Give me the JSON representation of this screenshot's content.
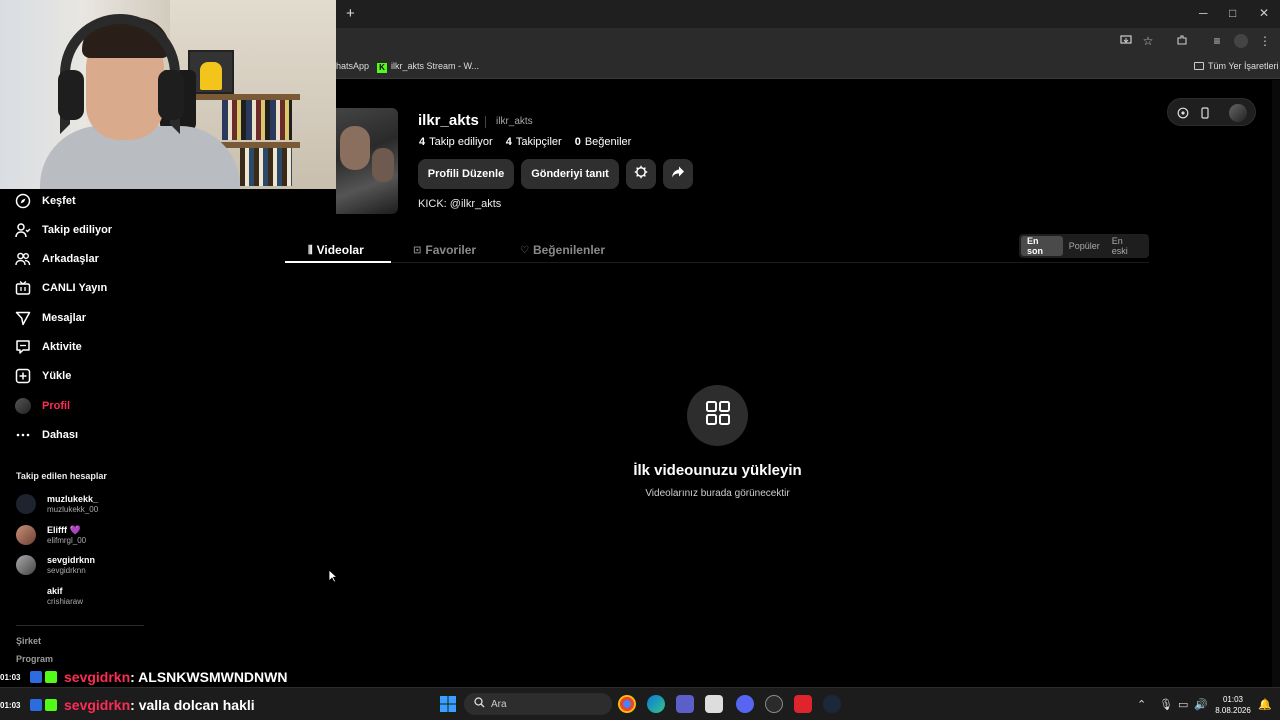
{
  "browser": {
    "new_tab": "+",
    "window_controls": {
      "minimize": "─",
      "maximize": "□",
      "close": "✕"
    },
    "bookmarks": [
      {
        "label": "hatsApp"
      },
      {
        "label": "ilkr_akts Stream - W..."
      }
    ],
    "all_bookmarks": "Tüm Yer İşaretleri"
  },
  "sidebar": {
    "items": [
      {
        "label": "Keşfet"
      },
      {
        "label": "Takip ediliyor"
      },
      {
        "label": "Arkadaşlar"
      },
      {
        "label": "CANLI Yayın"
      },
      {
        "label": "Mesajlar"
      },
      {
        "label": "Aktivite"
      },
      {
        "label": "Yükle"
      },
      {
        "label": "Profil"
      },
      {
        "label": "Dahası"
      }
    ],
    "following_title": "Takip edilen hesaplar",
    "accounts": [
      {
        "name": "muzlukekk_",
        "handle": "muzlukekk_00"
      },
      {
        "name": "Elifff 💜",
        "handle": "elifmrgl_00"
      },
      {
        "name": "sevgidrknn",
        "handle": "sevgidrknn"
      },
      {
        "name": "akif",
        "handle": "crishiaraw"
      }
    ],
    "footer_links": [
      "Şirket",
      "Program"
    ]
  },
  "profile": {
    "username": "ilkr_akts",
    "nickname": "ilkr_akts",
    "stats": [
      {
        "value": "4",
        "label": "Takip ediliyor"
      },
      {
        "value": "4",
        "label": "Takipçiler"
      },
      {
        "value": "0",
        "label": "Beğeniler"
      }
    ],
    "edit_button": "Profili Düzenle",
    "promote_button": "Gönderiyi tanıt",
    "bio": "KICK: @ilkr_akts"
  },
  "tabs": [
    {
      "label": "Videolar"
    },
    {
      "label": "Favoriler"
    },
    {
      "label": "Beğenilenler"
    }
  ],
  "sort_options": [
    "En son",
    "Popüler",
    "En eski"
  ],
  "empty_state": {
    "title": "İlk videounuzu yükleyin",
    "subtitle": "Videolarınız burada görünecektir"
  },
  "chat": [
    {
      "time": "01:03",
      "user": "sevgidrkn",
      "message": ": ALSNKWSMWNDNWN"
    },
    {
      "time": "01:03",
      "user": "sevgidrkn",
      "message": ": valla dolcan hakli"
    }
  ],
  "taskbar": {
    "search_placeholder": "Ara",
    "time": "01:03",
    "date": "8.08.2026"
  },
  "colors": {
    "accent": "#fe2c55",
    "kick_green": "#53fc18"
  }
}
